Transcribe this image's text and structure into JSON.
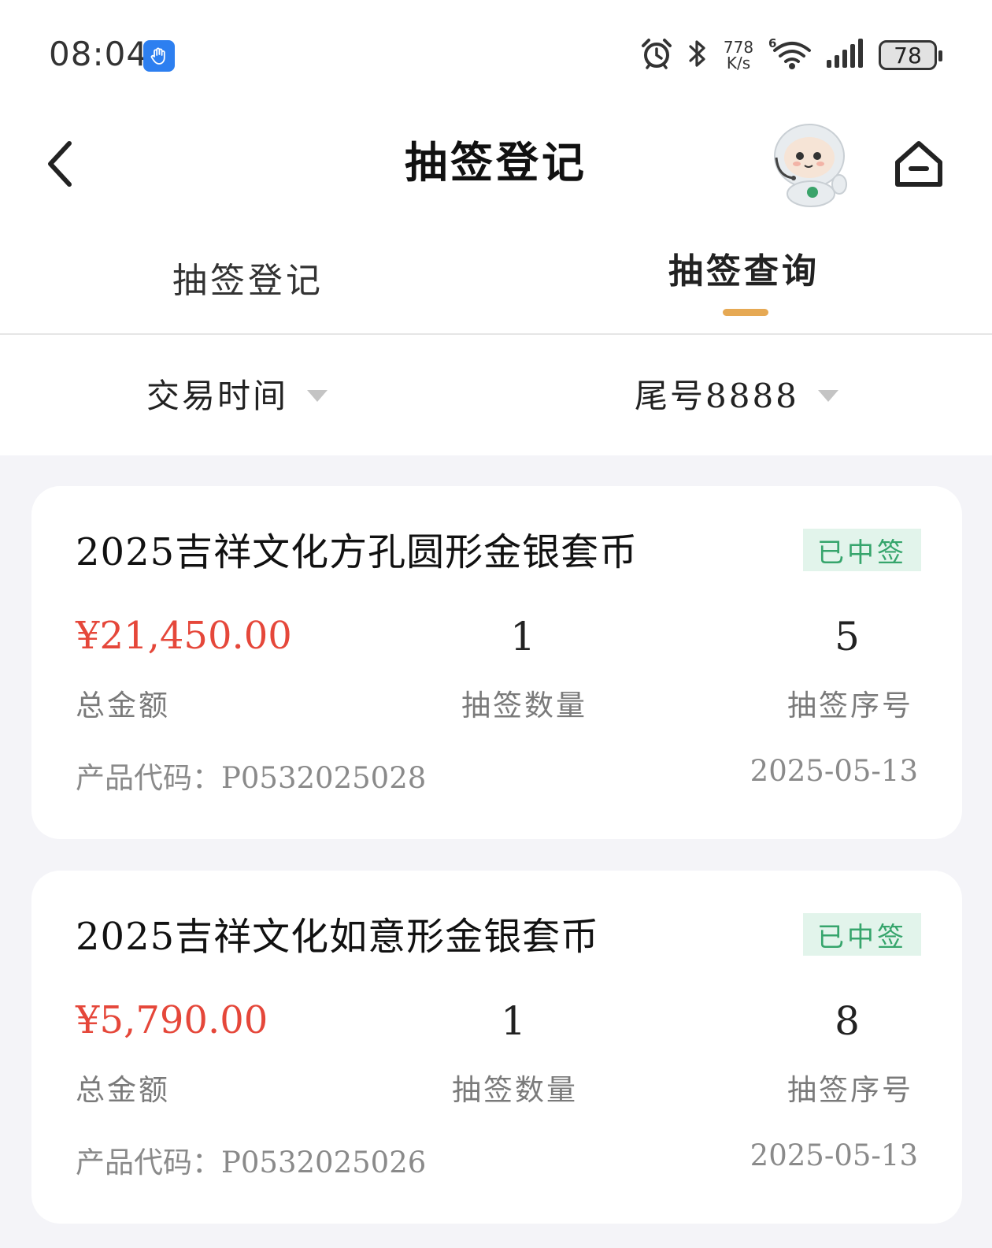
{
  "status_bar": {
    "time": "08:04",
    "speed_value": "778",
    "speed_unit": "K/s",
    "battery": "78",
    "icons": [
      "app-notification-icon",
      "alarm-icon",
      "bluetooth-icon",
      "wifi-6-icon",
      "signal-icon",
      "battery-icon"
    ]
  },
  "navbar": {
    "title": "抽签登记",
    "icons": [
      "back-icon",
      "robot-assistant-icon",
      "home-icon"
    ]
  },
  "tabs": [
    {
      "label": "抽签登记",
      "active": false
    },
    {
      "label": "抽签查询",
      "active": true
    }
  ],
  "filters": [
    {
      "label": "交易时间"
    },
    {
      "label": "尾号8888"
    }
  ],
  "colors": {
    "accent_underline": "#e6a954",
    "amount_red": "#e5473a",
    "badge_green": "#36a56c",
    "badge_bg": "#e2f4eb",
    "page_bg": "#f4f4f8"
  },
  "labels": {
    "total_amount": "总金额",
    "lottery_quantity": "抽签数量",
    "lottery_number": "抽签序号",
    "product_code_prefix": "产品代码："
  },
  "records": [
    {
      "title": "2025吉祥文化方孔圆形金银套币",
      "status": "已中签",
      "amount": "¥21,450.00",
      "quantity": "1",
      "sequence": "5",
      "product_code": "P0532025028",
      "date": "2025-05-13"
    },
    {
      "title": "2025吉祥文化如意形金银套币",
      "status": "已中签",
      "amount": "¥5,790.00",
      "quantity": "1",
      "sequence": "8",
      "product_code": "P0532025026",
      "date": "2025-05-13"
    }
  ]
}
